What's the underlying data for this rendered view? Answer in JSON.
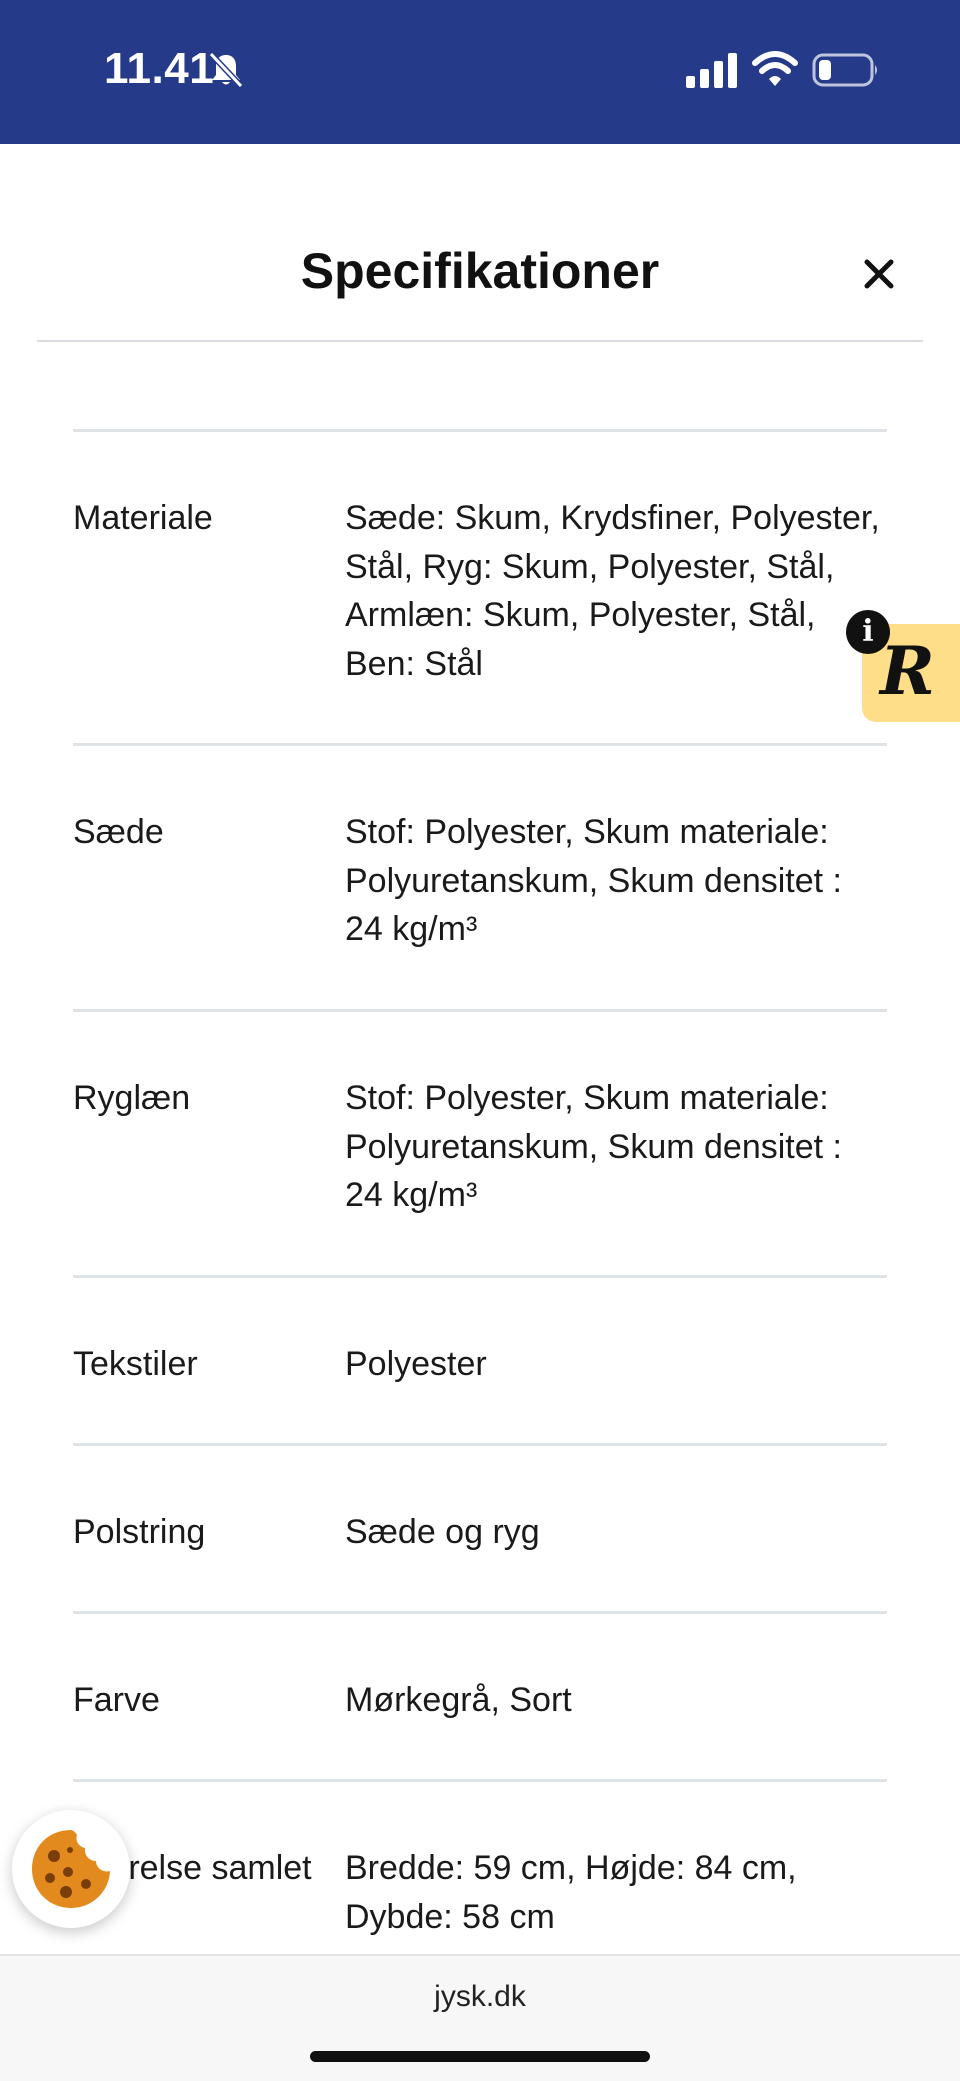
{
  "status_bar": {
    "time": "11.41",
    "background_color": "#253b8a",
    "icons": [
      "bell-muted-icon",
      "signal-icon",
      "wifi-icon",
      "battery-icon"
    ]
  },
  "header": {
    "title": "Specifikationer",
    "close_icon": "close-icon"
  },
  "specs": [
    {
      "label": "Materiale",
      "value": "Sæde: Skum, Krydsfiner, Polyester, Stål, Ryg: Skum, Polyester, Stål, Armlæn: Skum, Polyester, Stål, Ben: Stål"
    },
    {
      "label": "Sæde",
      "value": "Stof: Polyester, Skum materiale: Polyuretanskum, Skum densitet : 24 kg/m³"
    },
    {
      "label": "Ryglæn",
      "value": "Stof: Polyester, Skum materiale: Polyuretanskum, Skum densitet : 24 kg/m³"
    },
    {
      "label": "Tekstiler",
      "value": "Polyester"
    },
    {
      "label": "Polstring",
      "value": "Sæde og ryg"
    },
    {
      "label": "Farve",
      "value": "Mørkegrå, Sort"
    },
    {
      "label": "rrelse samlet",
      "value": "Bredde: 59 cm, Højde: 84 cm, Dybde: 58 cm"
    }
  ],
  "badge": {
    "letter": "R",
    "info": "i",
    "color": "#ffde8a"
  },
  "cookie": {
    "icon": "cookie-icon"
  },
  "browser": {
    "url": "jysk.dk"
  }
}
